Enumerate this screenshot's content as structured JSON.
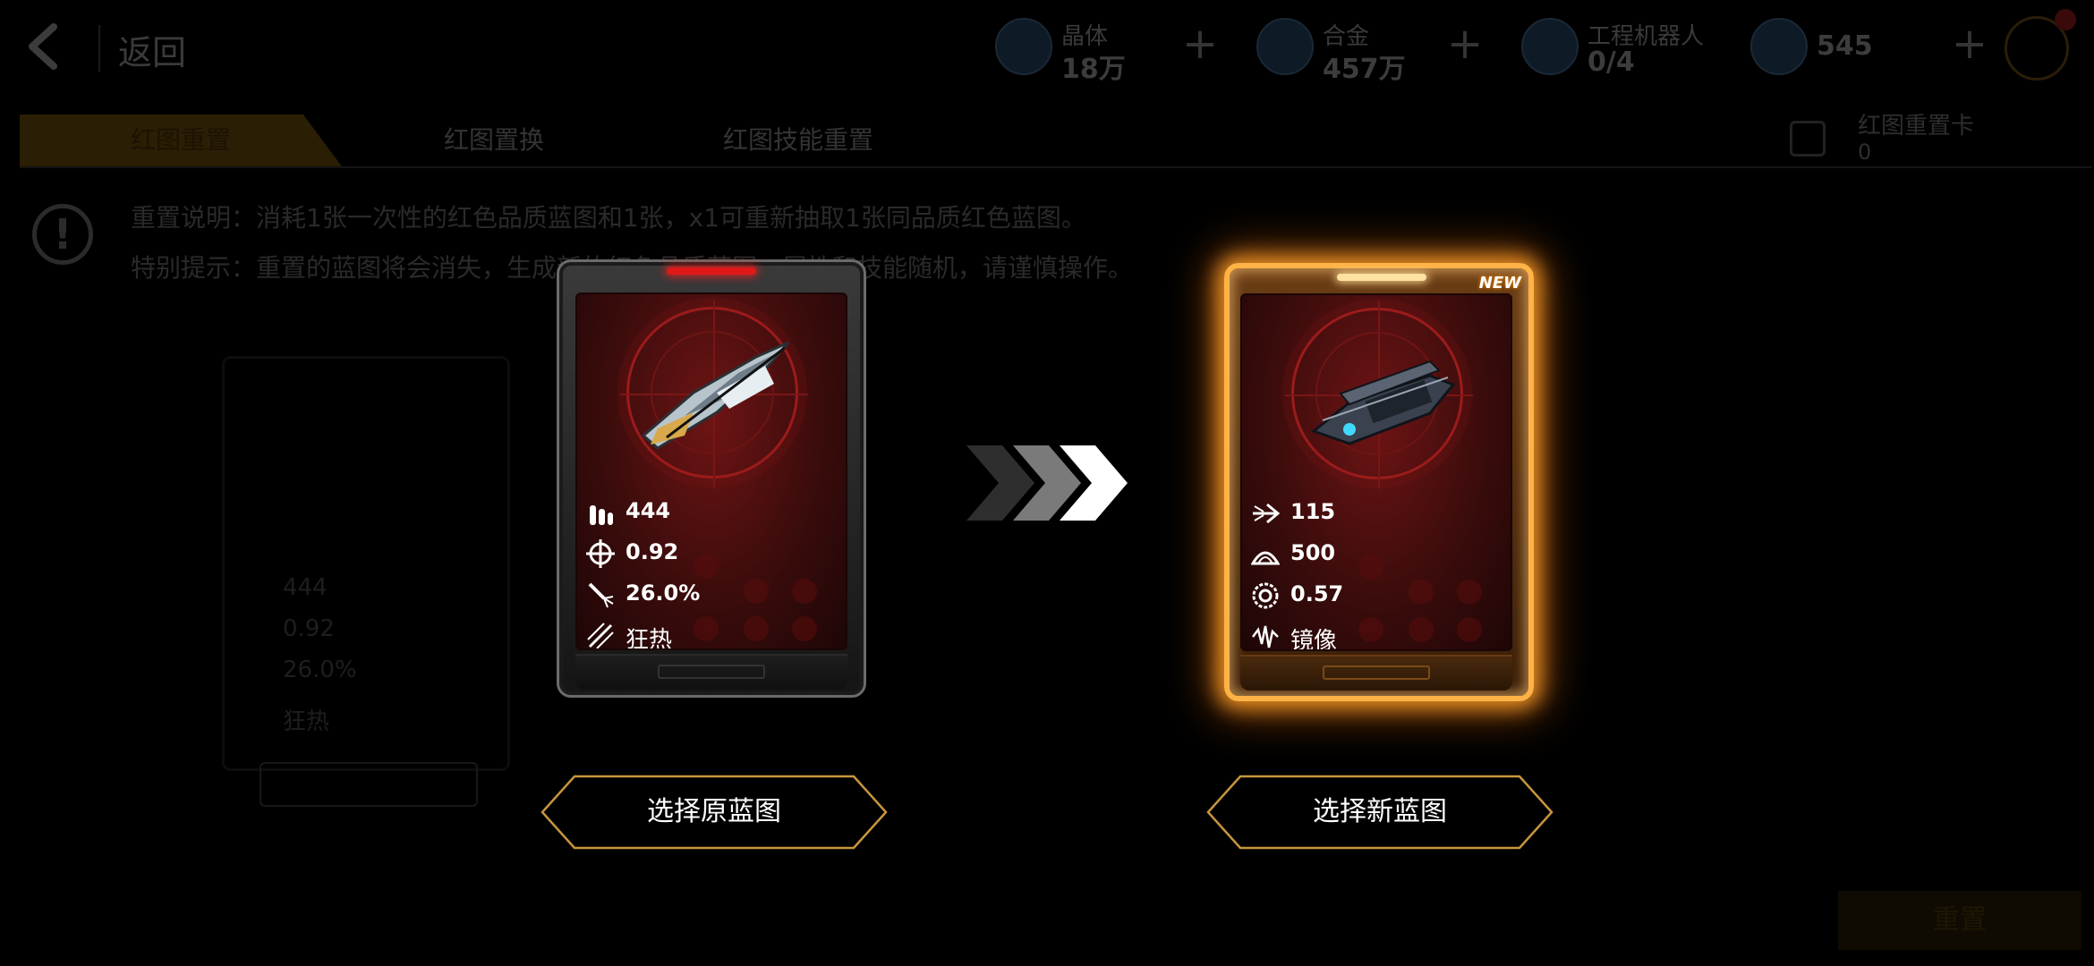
{
  "topbar": {
    "back_label": "返回",
    "resources": [
      {
        "icon": "crystal-icon",
        "name": "晶体",
        "value": "18万"
      },
      {
        "icon": "alloy-icon",
        "name": "合金",
        "value": "457万"
      },
      {
        "icon": "robot-icon",
        "name": "工程机器人",
        "value": "0/4"
      },
      {
        "icon": "coin-icon",
        "name": "",
        "value": "545"
      }
    ],
    "plus": "+",
    "cart_icon": "cart-icon"
  },
  "tabs": [
    {
      "label": "红图重置",
      "active": true
    },
    {
      "label": "红图置换",
      "active": false
    },
    {
      "label": "红图技能重置",
      "active": false
    }
  ],
  "card_counter": {
    "label": "红图重置卡",
    "value": "0"
  },
  "info": {
    "line1": "重置说明：消耗1张一次性的红色品质蓝图和1张，x1可重新抽取1张同品质红色蓝图。",
    "line2": "特别提示：重置的蓝图将会消失，生成新的红色品质蓝图，属性和技能随机，请谨慎操作。"
  },
  "background_card": {
    "stats": [
      "444",
      "0.92",
      "26.0%",
      "狂热"
    ]
  },
  "confirm_label": "重置",
  "modal": {
    "old_card": {
      "stats": [
        {
          "icon": "ammo-icon",
          "value": "444"
        },
        {
          "icon": "crosshair-icon",
          "value": "0.92"
        },
        {
          "icon": "missile-burst-icon",
          "value": "26.0%"
        },
        {
          "icon": "skill-slash-icon",
          "value": "狂热"
        }
      ],
      "button": "选择原蓝图"
    },
    "new_card": {
      "badge": "NEW",
      "stats": [
        {
          "icon": "speed-arrow-icon",
          "value": "115"
        },
        {
          "icon": "armor-plate-icon",
          "value": "500"
        },
        {
          "icon": "gear-shield-icon",
          "value": "0.57"
        },
        {
          "icon": "mirror-skill-icon",
          "value": "镜像"
        }
      ],
      "button": "选择新蓝图"
    },
    "colors": {
      "button_border": "#d4a24a",
      "glow": "#ffa53a",
      "card_red": "#6e1414"
    }
  }
}
